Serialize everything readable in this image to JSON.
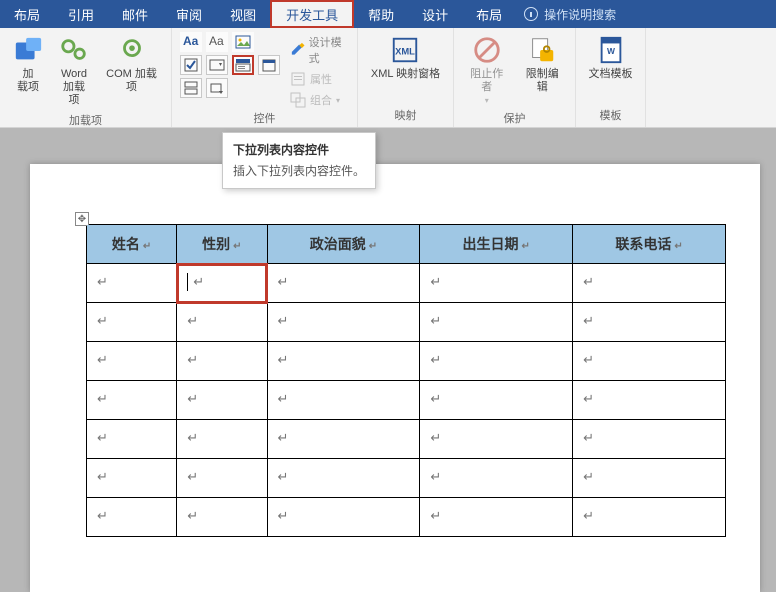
{
  "tabs": {
    "layout1": "布局",
    "references": "引用",
    "mailings": "邮件",
    "review": "审阅",
    "view": "视图",
    "developer": "开发工具",
    "help": "帮助",
    "design": "设计",
    "layout2": "布局",
    "tell_me": "操作说明搜索"
  },
  "ribbon": {
    "addins": {
      "label": "加载项",
      "addins_btn": "加\n载项",
      "word_addins": "Word\n加载项",
      "com_addins": "COM 加载项"
    },
    "controls": {
      "label": "控件",
      "design_mode": "设计模式",
      "properties": "属性",
      "group": "组合"
    },
    "mapping": {
      "label": "映射",
      "xml_pane": "XML 映射窗格"
    },
    "protect": {
      "label": "保护",
      "block_authors": "阻止作者",
      "restrict_editing": "限制编辑"
    },
    "templates": {
      "label": "模板",
      "doc_template": "文档模板"
    }
  },
  "tooltip": {
    "title": "下拉列表内容控件",
    "body": "插入下拉列表内容控件。"
  },
  "table": {
    "headers": [
      "姓名",
      "性别",
      "政治面貌",
      "出生日期",
      "联系电话"
    ],
    "rows": 7
  }
}
